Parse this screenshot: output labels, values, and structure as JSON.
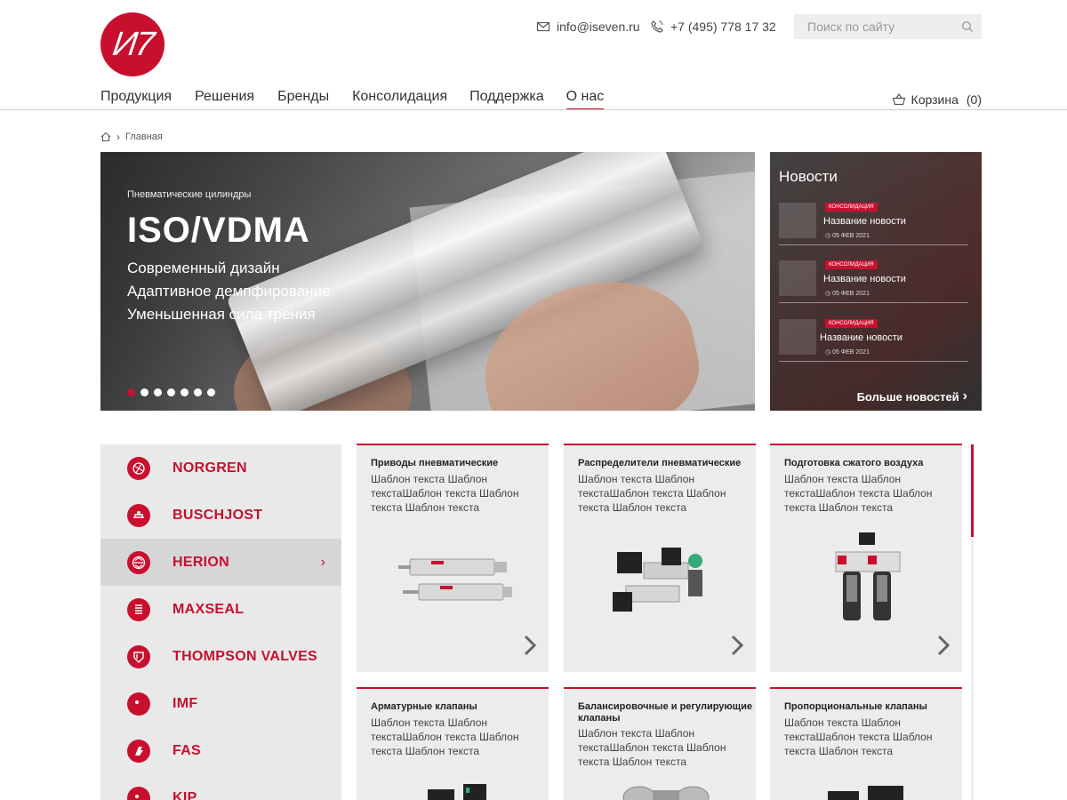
{
  "header": {
    "logo_text": "И7",
    "email": "info@iseven.ru",
    "phone": "+7 (495) 778 17 32",
    "search_placeholder": "Поиск по сайту"
  },
  "nav": {
    "items": [
      "Продукция",
      "Решения",
      "Бренды",
      "Консолидация",
      "Поддержка",
      "О нас"
    ],
    "active_index": 5,
    "cart_label": "Корзина",
    "cart_count": "(0)"
  },
  "breadcrumb": {
    "current": "Главная"
  },
  "hero": {
    "subtitle": "Пневматические цилиндры",
    "title": "ISO/VDMA",
    "lines": [
      "Современный дизайн",
      "Адаптивное демпфирование",
      "Уменьшенная сила трения"
    ],
    "slides_count": 7,
    "active_slide": 1
  },
  "news": {
    "title": "Новости",
    "items": [
      {
        "tag": "Консолидация",
        "name": "Название новости",
        "date": "05 ФЕВ 2021"
      },
      {
        "tag": "Консолидация",
        "name": "Название новости",
        "date": "05 ФЕВ 2021"
      },
      {
        "tag": "Консолидация",
        "name": "Название новости",
        "date": "05 ФЕВ 2021"
      }
    ],
    "more_label": "Больше новостей"
  },
  "brands": {
    "items": [
      "NORGREN",
      "BUSCHJOST",
      "HERION",
      "MAXSEAL",
      "THOMPSON VALVES",
      "IMF",
      "FAS",
      "KIP"
    ],
    "active_index": 2
  },
  "categories": [
    {
      "title": "Приводы пневматические",
      "desc": "Шаблон текста Шаблон текстаШаблон текста Шаблон текста Шаблон текста"
    },
    {
      "title": "Распределители пневматические",
      "desc": "Шаблон текста Шаблон текстаШаблон текста Шаблон текста Шаблон текста"
    },
    {
      "title": "Подготовка сжатого воздуха",
      "desc": "Шаблон текста Шаблон текстаШаблон текста Шаблон текста Шаблон текста"
    },
    {
      "title": "Арматурные клапаны",
      "desc": "Шаблон текста Шаблон текстаШаблон текста Шаблон текста Шаблон текста"
    },
    {
      "title": "Балансировочные и регулирующие клапаны",
      "desc": "Шаблон текста Шаблон текстаШаблон текста Шаблон текста Шаблон текста"
    },
    {
      "title": "Пропорциональные клапаны",
      "desc": "Шаблон текста Шаблон текстаШаблон текста Шаблон текста Шаблон текста"
    }
  ],
  "colors": {
    "accent": "#c8102e",
    "panel": "#ececec"
  }
}
